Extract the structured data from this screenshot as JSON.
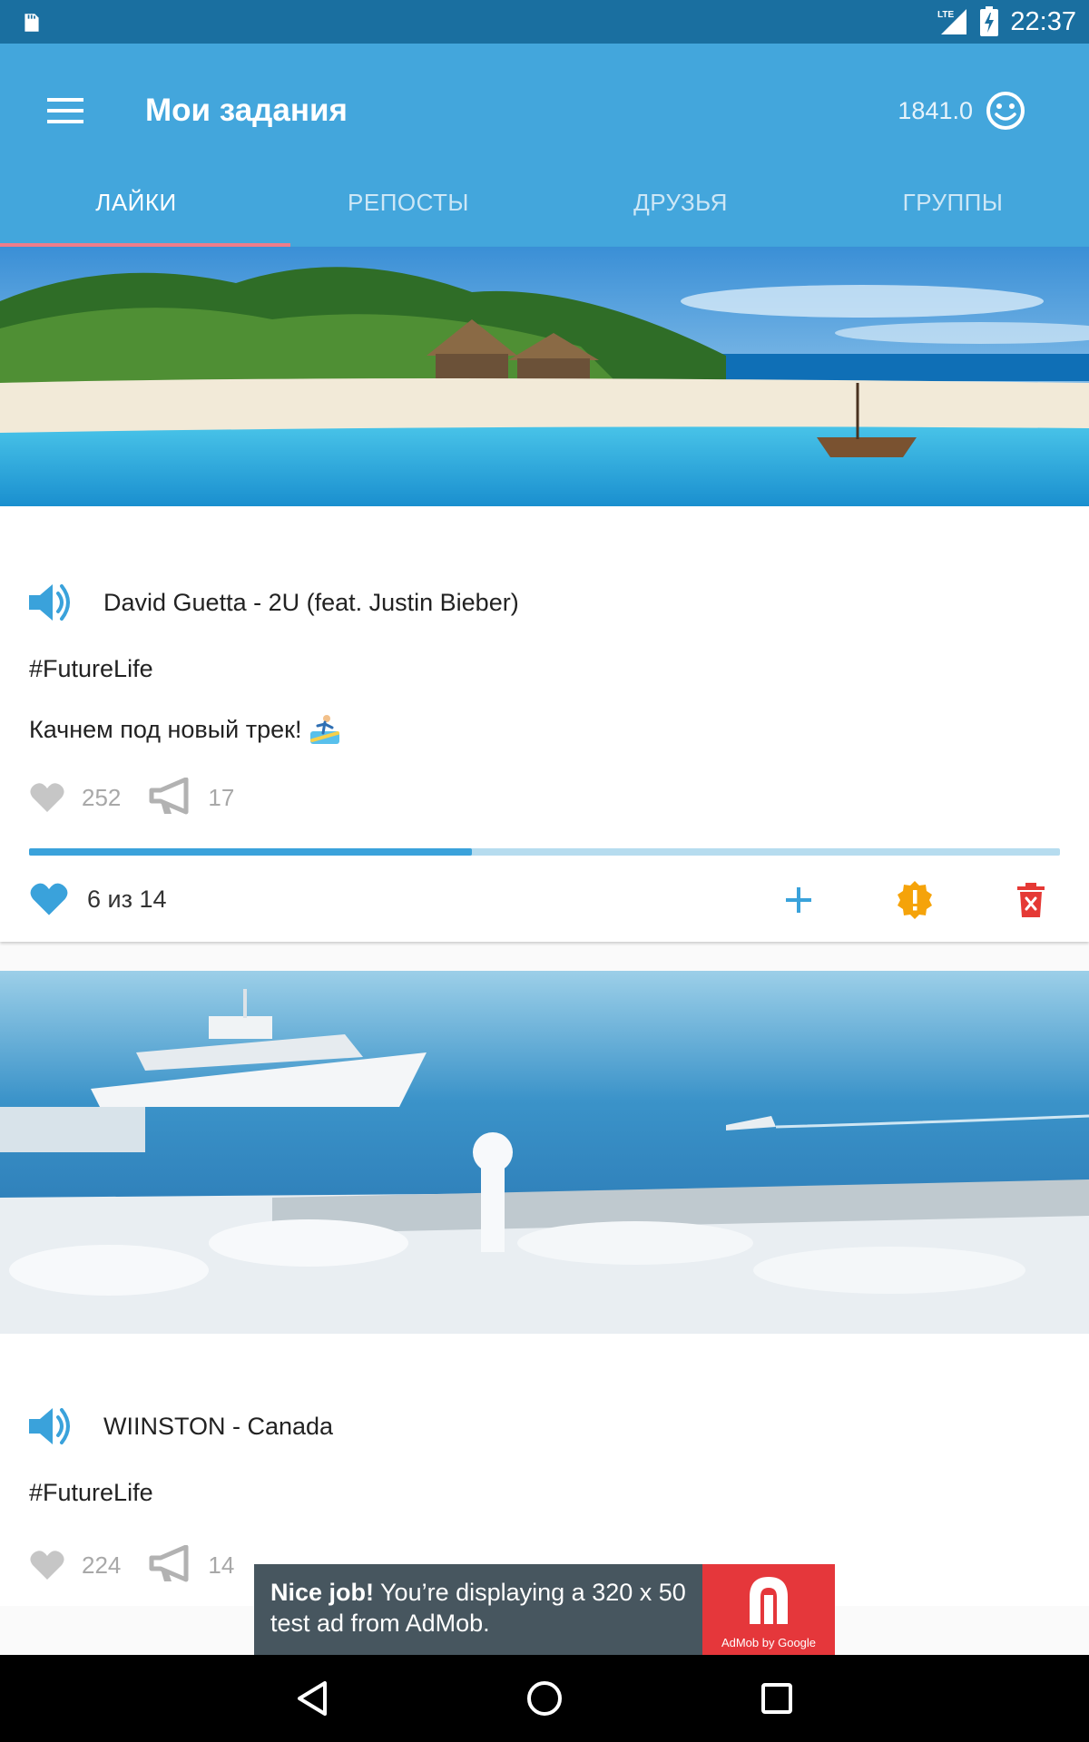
{
  "status_bar": {
    "time": "22:37",
    "network": "LTE"
  },
  "app_bar": {
    "title": "Мои задания",
    "balance": "1841.0"
  },
  "tabs": [
    {
      "label": "ЛАЙКИ",
      "active": true
    },
    {
      "label": "РЕПОСТЫ",
      "active": false
    },
    {
      "label": "ДРУЗЬЯ",
      "active": false
    },
    {
      "label": "ГРУППЫ",
      "active": false
    }
  ],
  "posts": [
    {
      "track": "David Guetta - 2U (feat. Justin Bieber)",
      "hashtag": "#FutureLife",
      "text": "Качнем под новый трек!",
      "likes": "252",
      "reposts": "17",
      "progress_fraction": 0.43,
      "progress_label": "6 из 14"
    },
    {
      "track": "WIINSTON - Canada",
      "hashtag": "#FutureLife",
      "likes": "224",
      "reposts": "14"
    }
  ],
  "ad": {
    "headline": "Nice job!",
    "text": "You’re displaying a 320 x 50 test ad from AdMob.",
    "logo_caption": "AdMob by Google"
  },
  "colors": {
    "app_bar": "#43a6dc",
    "status_bar": "#1a6fa0",
    "accent_blue": "#3aa2db",
    "tab_indicator": "#ef7d8a",
    "warning": "#f5a30a",
    "delete": "#e53935",
    "ad_red": "#e5373b"
  },
  "icons": [
    "menu-icon",
    "smiley-icon",
    "speaker-icon",
    "heart-icon",
    "megaphone-icon",
    "plus-icon",
    "warning-icon",
    "trash-icon",
    "back-icon",
    "home-icon",
    "recents-icon"
  ]
}
